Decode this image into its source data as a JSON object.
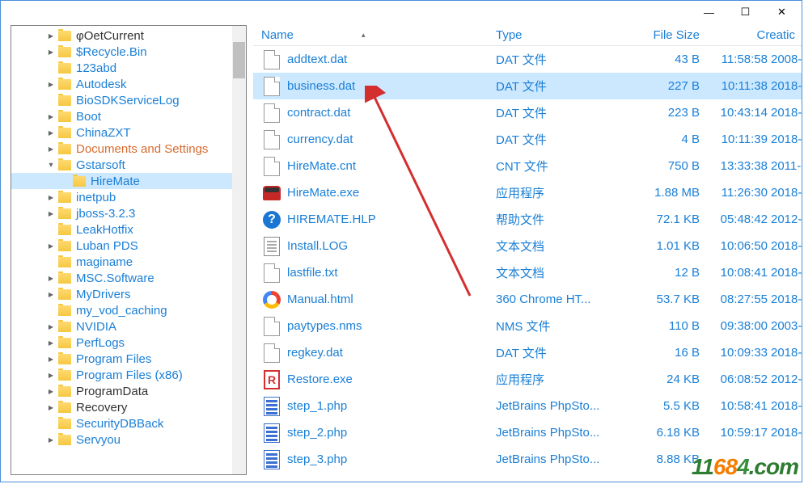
{
  "titlebar": {
    "minimize": "—",
    "maximize": "☐",
    "close": "✕"
  },
  "tree": {
    "items": [
      {
        "label": "φOetCurrent",
        "depth": 1,
        "expander": ">",
        "selected": false,
        "dark": true
      },
      {
        "label": "$Recycle.Bin",
        "depth": 1,
        "expander": ">",
        "selected": false
      },
      {
        "label": "123abd",
        "depth": 1,
        "expander": "",
        "selected": false
      },
      {
        "label": "Autodesk",
        "depth": 1,
        "expander": ">",
        "selected": false
      },
      {
        "label": "BioSDKServiceLog",
        "depth": 1,
        "expander": "",
        "selected": false
      },
      {
        "label": "Boot",
        "depth": 1,
        "expander": ">",
        "selected": false
      },
      {
        "label": "ChinaZXT",
        "depth": 1,
        "expander": ">",
        "selected": false
      },
      {
        "label": "Documents and Settings",
        "depth": 1,
        "expander": ">",
        "selected": false,
        "orange": true
      },
      {
        "label": "Gstarsoft",
        "depth": 1,
        "expander": "v",
        "selected": false
      },
      {
        "label": "HireMate",
        "depth": 2,
        "expander": "",
        "selected": true
      },
      {
        "label": "inetpub",
        "depth": 1,
        "expander": ">",
        "selected": false
      },
      {
        "label": "jboss-3.2.3",
        "depth": 1,
        "expander": ">",
        "selected": false
      },
      {
        "label": "LeakHotfix",
        "depth": 1,
        "expander": "",
        "selected": false
      },
      {
        "label": "Luban PDS",
        "depth": 1,
        "expander": ">",
        "selected": false
      },
      {
        "label": "maginame",
        "depth": 1,
        "expander": "",
        "selected": false
      },
      {
        "label": "MSC.Software",
        "depth": 1,
        "expander": ">",
        "selected": false
      },
      {
        "label": "MyDrivers",
        "depth": 1,
        "expander": ">",
        "selected": false
      },
      {
        "label": "my_vod_caching",
        "depth": 1,
        "expander": "",
        "selected": false
      },
      {
        "label": "NVIDIA",
        "depth": 1,
        "expander": ">",
        "selected": false
      },
      {
        "label": "PerfLogs",
        "depth": 1,
        "expander": ">",
        "selected": false
      },
      {
        "label": "Program Files",
        "depth": 1,
        "expander": ">",
        "selected": false
      },
      {
        "label": "Program Files (x86)",
        "depth": 1,
        "expander": ">",
        "selected": false
      },
      {
        "label": "ProgramData",
        "depth": 1,
        "expander": ">",
        "selected": false,
        "dark": true
      },
      {
        "label": "Recovery",
        "depth": 1,
        "expander": ">",
        "selected": false,
        "dark": true
      },
      {
        "label": "SecurityDBBack",
        "depth": 1,
        "expander": "",
        "selected": false
      },
      {
        "label": "Servyou",
        "depth": 1,
        "expander": ">",
        "selected": false
      }
    ]
  },
  "list": {
    "headers": {
      "name": "Name",
      "type": "Type",
      "size": "File Size",
      "creation": "Creatic"
    },
    "rows": [
      {
        "name": "addtext.dat",
        "type": "DAT 文件",
        "size": "43 B",
        "time": "11:58:58",
        "year": "2008-",
        "icon": "page",
        "selected": false
      },
      {
        "name": "business.dat",
        "type": "DAT 文件",
        "size": "227 B",
        "time": "10:11:38",
        "year": "2018-",
        "icon": "page",
        "selected": true
      },
      {
        "name": "contract.dat",
        "type": "DAT 文件",
        "size": "223 B",
        "time": "10:43:14",
        "year": "2018-",
        "icon": "page",
        "selected": false
      },
      {
        "name": "currency.dat",
        "type": "DAT 文件",
        "size": "4 B",
        "time": "10:11:39",
        "year": "2018-",
        "icon": "page",
        "selected": false
      },
      {
        "name": "HireMate.cnt",
        "type": "CNT 文件",
        "size": "750 B",
        "time": "13:33:38",
        "year": "2011-",
        "icon": "page",
        "selected": false
      },
      {
        "name": "HireMate.exe",
        "type": "应用程序",
        "size": "1.88 MB",
        "time": "11:26:30",
        "year": "2018-",
        "icon": "car",
        "selected": false
      },
      {
        "name": "HIREMATE.HLP",
        "type": "帮助文件",
        "size": "72.1 KB",
        "time": "05:48:42",
        "year": "2012-",
        "icon": "help",
        "selected": false
      },
      {
        "name": "Install.LOG",
        "type": "文本文档",
        "size": "1.01 KB",
        "time": "10:06:50",
        "year": "2018-",
        "icon": "text",
        "selected": false
      },
      {
        "name": "lastfile.txt",
        "type": "文本文档",
        "size": "12 B",
        "time": "10:08:41",
        "year": "2018-",
        "icon": "page",
        "selected": false
      },
      {
        "name": "Manual.html",
        "type": "360 Chrome HT...",
        "size": "53.7 KB",
        "time": "08:27:55",
        "year": "2018-",
        "icon": "chrome",
        "selected": false
      },
      {
        "name": "paytypes.nms",
        "type": "NMS 文件",
        "size": "110 B",
        "time": "09:38:00",
        "year": "2003-",
        "icon": "page",
        "selected": false
      },
      {
        "name": "regkey.dat",
        "type": "DAT 文件",
        "size": "16 B",
        "time": "10:09:33",
        "year": "2018-",
        "icon": "page",
        "selected": false
      },
      {
        "name": "Restore.exe",
        "type": "应用程序",
        "size": "24 KB",
        "time": "06:08:52",
        "year": "2012-",
        "icon": "r",
        "selected": false
      },
      {
        "name": "step_1.php",
        "type": "JetBrains PhpSto...",
        "size": "5.5 KB",
        "time": "10:58:41",
        "year": "2018-",
        "icon": "php",
        "selected": false
      },
      {
        "name": "step_2.php",
        "type": "JetBrains PhpSto...",
        "size": "6.18 KB",
        "time": "10:59:17",
        "year": "2018-",
        "icon": "php",
        "selected": false
      },
      {
        "name": "step_3.php",
        "type": "JetBrains PhpSto...",
        "size": "8.88 KB",
        "time": "",
        "year": "",
        "icon": "php",
        "selected": false
      }
    ]
  },
  "watermark": {
    "text": "11684.com"
  }
}
